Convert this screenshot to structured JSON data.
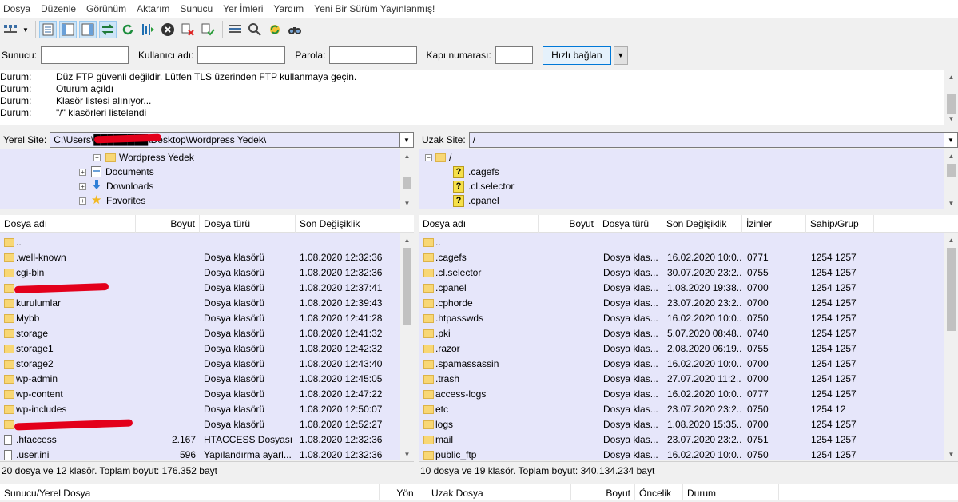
{
  "menu": [
    "Dosya",
    "Düzenle",
    "Görünüm",
    "Aktarım",
    "Sunucu",
    "Yer İmleri",
    "Yardım",
    "Yeni Bir Sürüm Yayınlanmış!"
  ],
  "toolbar": {
    "icons": [
      "site-manager-icon",
      "dropdown-arrow-icon",
      "message-log-icon",
      "local-tree-icon",
      "remote-tree-icon",
      "transfer-queue-icon",
      "refresh-icon",
      "process-queue-icon",
      "cancel-icon",
      "disconnect-icon",
      "reconnect-icon",
      "directory-compare-icon",
      "filter-icon",
      "sync-browse-icon",
      "search-icon"
    ]
  },
  "quickconnect": {
    "host_label": "Sunucu:",
    "host_value": "",
    "user_label": "Kullanıcı adı:",
    "user_value": "",
    "pass_label": "Parola:",
    "pass_value": "",
    "port_label": "Kapı numarası:",
    "port_value": "",
    "button": "Hızlı bağlan"
  },
  "log": [
    {
      "type": "Durum:",
      "msg": "Düz FTP güvenli değildir. Lütfen TLS üzerinden FTP kullanmaya geçin."
    },
    {
      "type": "Durum:",
      "msg": "Oturum açıldı"
    },
    {
      "type": "Durum:",
      "msg": "Klasör listesi alınıyor..."
    },
    {
      "type": "Durum:",
      "msg": "\"/\" klasörleri listelendi"
    }
  ],
  "local": {
    "site_label": "Yerel Site:",
    "path": "C:\\Users\\████████\\Desktop\\Wordpress Yedek\\",
    "tree": [
      "Wordpress Yedek",
      "Documents",
      "Downloads",
      "Favorites"
    ],
    "columns": [
      "Dosya adı",
      "Boyut",
      "Dosya türü",
      "Son Değişiklik"
    ],
    "files": [
      {
        "name": "..",
        "size": "",
        "type": "",
        "modified": ""
      },
      {
        "name": ".well-known",
        "size": "",
        "type": "Dosya klasörü",
        "modified": "1.08.2020 12:32:36"
      },
      {
        "name": "cgi-bin",
        "size": "",
        "type": "Dosya klasörü",
        "modified": "1.08.2020 12:32:36"
      },
      {
        "name": "",
        "size": "",
        "type": "Dosya klasörü",
        "modified": "1.08.2020 12:37:41",
        "redacted": true
      },
      {
        "name": "kurulumlar",
        "size": "",
        "type": "Dosya klasörü",
        "modified": "1.08.2020 12:39:43"
      },
      {
        "name": "Mybb",
        "size": "",
        "type": "Dosya klasörü",
        "modified": "1.08.2020 12:41:28"
      },
      {
        "name": "storage",
        "size": "",
        "type": "Dosya klasörü",
        "modified": "1.08.2020 12:41:32"
      },
      {
        "name": "storage1",
        "size": "",
        "type": "Dosya klasörü",
        "modified": "1.08.2020 12:42:32"
      },
      {
        "name": "storage2",
        "size": "",
        "type": "Dosya klasörü",
        "modified": "1.08.2020 12:43:40"
      },
      {
        "name": "wp-admin",
        "size": "",
        "type": "Dosya klasörü",
        "modified": "1.08.2020 12:45:05"
      },
      {
        "name": "wp-content",
        "size": "",
        "type": "Dosya klasörü",
        "modified": "1.08.2020 12:47:22"
      },
      {
        "name": "wp-includes",
        "size": "",
        "type": "Dosya klasörü",
        "modified": "1.08.2020 12:50:07"
      },
      {
        "name": "",
        "size": "",
        "type": "Dosya klasörü",
        "modified": "1.08.2020 12:52:27",
        "redacted": true
      },
      {
        "name": ".htaccess",
        "size": "2.167",
        "type": "HTACCESS Dosyası",
        "modified": "1.08.2020 12:32:36",
        "file": true
      },
      {
        "name": ".user.ini",
        "size": "596",
        "type": "Yapılandırma ayarl...",
        "modified": "1.08.2020 12:32:36",
        "file": true
      }
    ],
    "status": "20 dosya ve 12 klasör. Toplam boyut: 176.352 bayt"
  },
  "remote": {
    "site_label": "Uzak Site:",
    "path": "/",
    "tree": [
      "/",
      ".cagefs",
      ".cl.selector",
      ".cpanel"
    ],
    "columns": [
      "Dosya adı",
      "Boyut",
      "Dosya türü",
      "Son Değişiklik",
      "İzinler",
      "Sahip/Grup"
    ],
    "files": [
      {
        "name": "..",
        "size": "",
        "type": "",
        "modified": "",
        "perm": "",
        "owner": ""
      },
      {
        "name": ".cagefs",
        "size": "",
        "type": "Dosya klas...",
        "modified": "16.02.2020 10:0...",
        "perm": "0771",
        "owner": "1254 1257"
      },
      {
        "name": ".cl.selector",
        "size": "",
        "type": "Dosya klas...",
        "modified": "30.07.2020 23:2...",
        "perm": "0755",
        "owner": "1254 1257"
      },
      {
        "name": ".cpanel",
        "size": "",
        "type": "Dosya klas...",
        "modified": "1.08.2020 19:38...",
        "perm": "0700",
        "owner": "1254 1257"
      },
      {
        "name": ".cphorde",
        "size": "",
        "type": "Dosya klas...",
        "modified": "23.07.2020 23:2...",
        "perm": "0700",
        "owner": "1254 1257"
      },
      {
        "name": ".htpasswds",
        "size": "",
        "type": "Dosya klas...",
        "modified": "16.02.2020 10:0...",
        "perm": "0750",
        "owner": "1254 1257"
      },
      {
        "name": ".pki",
        "size": "",
        "type": "Dosya klas...",
        "modified": "5.07.2020 08:48...",
        "perm": "0740",
        "owner": "1254 1257"
      },
      {
        "name": ".razor",
        "size": "",
        "type": "Dosya klas...",
        "modified": "2.08.2020 06:19...",
        "perm": "0755",
        "owner": "1254 1257"
      },
      {
        "name": ".spamassassin",
        "size": "",
        "type": "Dosya klas...",
        "modified": "16.02.2020 10:0...",
        "perm": "0700",
        "owner": "1254 1257"
      },
      {
        "name": ".trash",
        "size": "",
        "type": "Dosya klas...",
        "modified": "27.07.2020 11:2...",
        "perm": "0700",
        "owner": "1254 1257"
      },
      {
        "name": "access-logs",
        "size": "",
        "type": "Dosya klas...",
        "modified": "16.02.2020 10:0...",
        "perm": "0777",
        "owner": "1254 1257",
        "link": true
      },
      {
        "name": "etc",
        "size": "",
        "type": "Dosya klas...",
        "modified": "23.07.2020 23:2...",
        "perm": "0750",
        "owner": "1254 12"
      },
      {
        "name": "logs",
        "size": "",
        "type": "Dosya klas...",
        "modified": "1.08.2020 15:35...",
        "perm": "0700",
        "owner": "1254 1257"
      },
      {
        "name": "mail",
        "size": "",
        "type": "Dosya klas...",
        "modified": "23.07.2020 23:2...",
        "perm": "0751",
        "owner": "1254 1257"
      },
      {
        "name": "public_ftp",
        "size": "",
        "type": "Dosya klas...",
        "modified": "16.02.2020 10:0...",
        "perm": "0750",
        "owner": "1254 1257"
      }
    ],
    "status": "10 dosya ve 19 klasör. Toplam boyut: 340.134.234 bayt"
  },
  "queue": {
    "columns": [
      "Sunucu/Yerel Dosya",
      "Yön",
      "Uzak Dosya",
      "Boyut",
      "Öncelik",
      "Durum"
    ]
  },
  "colors": {
    "list_bg": "#e6e6fa",
    "folder": "#f8d775",
    "selected_btn": "#cce4f7",
    "redaction": "#e3001b"
  }
}
